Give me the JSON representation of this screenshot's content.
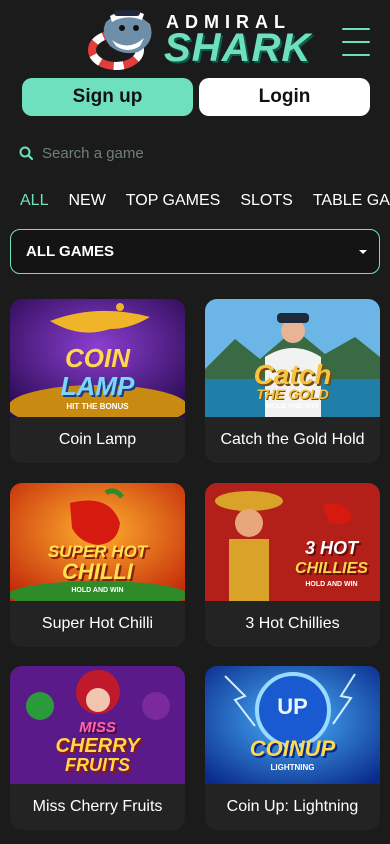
{
  "header": {
    "logo_top": "ADMIRAL",
    "logo_main": "SHARK",
    "menu_icon": "hamburger-icon"
  },
  "auth": {
    "signup_label": "Sign up",
    "login_label": "Login"
  },
  "search": {
    "placeholder": "Search a game",
    "icon": "search-icon"
  },
  "tabs": [
    {
      "label": "ALL",
      "active": true
    },
    {
      "label": "NEW"
    },
    {
      "label": "TOP GAMES"
    },
    {
      "label": "SLOTS"
    },
    {
      "label": "TABLE GA"
    }
  ],
  "filter": {
    "selected": "ALL GAMES",
    "icon": "caret-down-icon"
  },
  "games": [
    {
      "title": "Coin Lamp",
      "art_line1": "COIN",
      "art_line2": "LAMP",
      "art_sub": "HIT THE BONUS"
    },
    {
      "title": "Catch the Gold Hold",
      "art_line1": "Catch",
      "art_line2": "THE GOLD",
      "art_sub": "HOLD AND WIN"
    },
    {
      "title": "Super Hot Chilli",
      "art_line1": "SUPER HOT",
      "art_line2": "CHILLI",
      "art_sub": "HOLD AND WIN"
    },
    {
      "title": "3 Hot Chillies",
      "art_line1": "3 HOT",
      "art_line2": "CHILLIES",
      "art_sub": "HOLD AND WIN"
    },
    {
      "title": "Miss Cherry Fruits",
      "art_line1": "MISS",
      "art_line2": "CHERRY",
      "art_line3": "FRUITS"
    },
    {
      "title": "Coin Up: Lightning",
      "art_line1": "UP",
      "art_line2": "COINUP",
      "art_sub": "LIGHTNING"
    }
  ],
  "colors": {
    "accent": "#6fe0bd",
    "background": "#1b1b1b",
    "card": "#232323"
  }
}
